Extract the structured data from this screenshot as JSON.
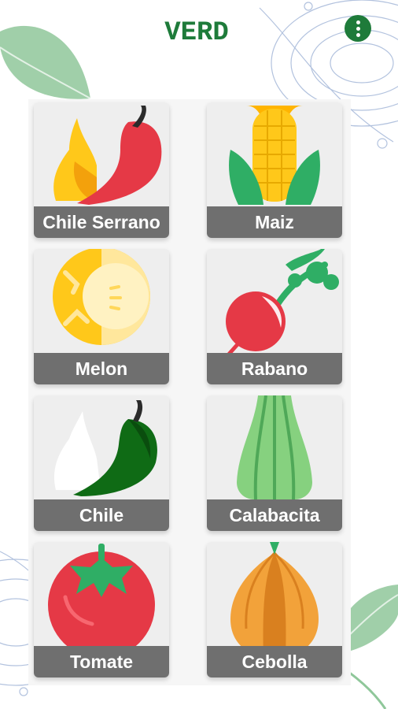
{
  "app": {
    "title": "VERD",
    "accent_color": "#1e7b3a"
  },
  "header": {
    "menu_icon": "more-vertical-icon"
  },
  "vegetables": [
    {
      "label": "Chile Serrano",
      "icon": "chile-serrano-icon"
    },
    {
      "label": "Maiz",
      "icon": "corn-icon"
    },
    {
      "label": "Melon",
      "icon": "melon-icon"
    },
    {
      "label": "Rabano",
      "icon": "radish-icon"
    },
    {
      "label": "Chile",
      "icon": "chile-icon"
    },
    {
      "label": "Calabacita",
      "icon": "squash-icon"
    },
    {
      "label": "Tomate",
      "icon": "tomato-icon"
    },
    {
      "label": "Cebolla",
      "icon": "onion-icon"
    }
  ]
}
